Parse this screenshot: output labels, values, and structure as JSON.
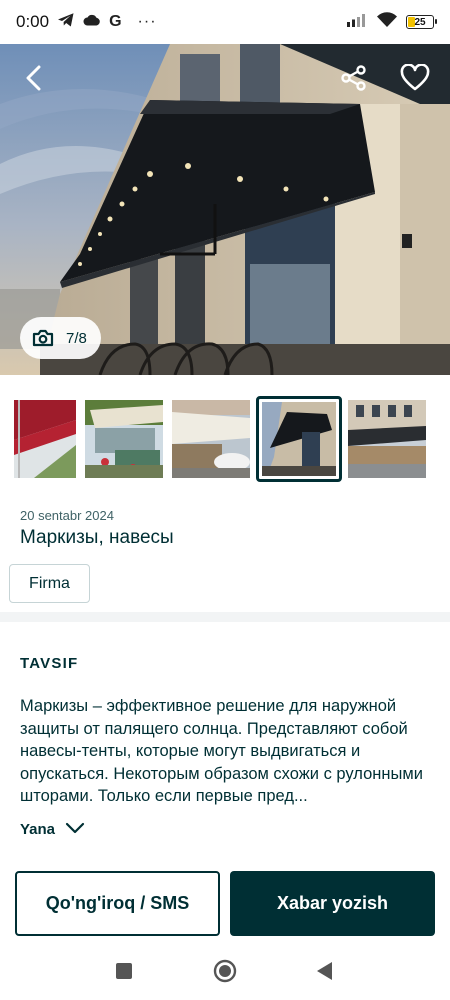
{
  "status_bar": {
    "time": "0:00",
    "carrier_letter": "G",
    "more": "···",
    "battery": "25",
    "icons": [
      "telegram-icon",
      "cloud-icon",
      "signal-icon",
      "wifi-icon",
      "battery-icon"
    ]
  },
  "hero": {
    "photo_counter": "7/8",
    "icons": [
      "back-arrow-icon",
      "share-icon",
      "heart-icon",
      "camera-icon"
    ]
  },
  "thumbnails": {
    "count": 5,
    "active_index": 3
  },
  "listing": {
    "date": "20 sentabr 2024",
    "title": "Маркизы, навесы",
    "chip": "Firma"
  },
  "description": {
    "heading": "TAVSIF",
    "text": "Маркизы – эффективное решение для наружной защиты от палящего солнца. Представляют собой навесы-тенты, которые могут выдвигаться и опускаться. Некоторым образом схожи с рулонными шторами. Только если первые пред...",
    "more_label": "Yana"
  },
  "actions": {
    "call_label": "Qo'ng'iroq / SMS",
    "message_label": "Xabar yozish"
  },
  "colors": {
    "primary": "#002f34",
    "background": "#ffffff",
    "divider": "#f2f4f5"
  },
  "nav_bar": {
    "icons": [
      "recents-square-icon",
      "home-circle-icon",
      "back-triangle-icon"
    ]
  }
}
